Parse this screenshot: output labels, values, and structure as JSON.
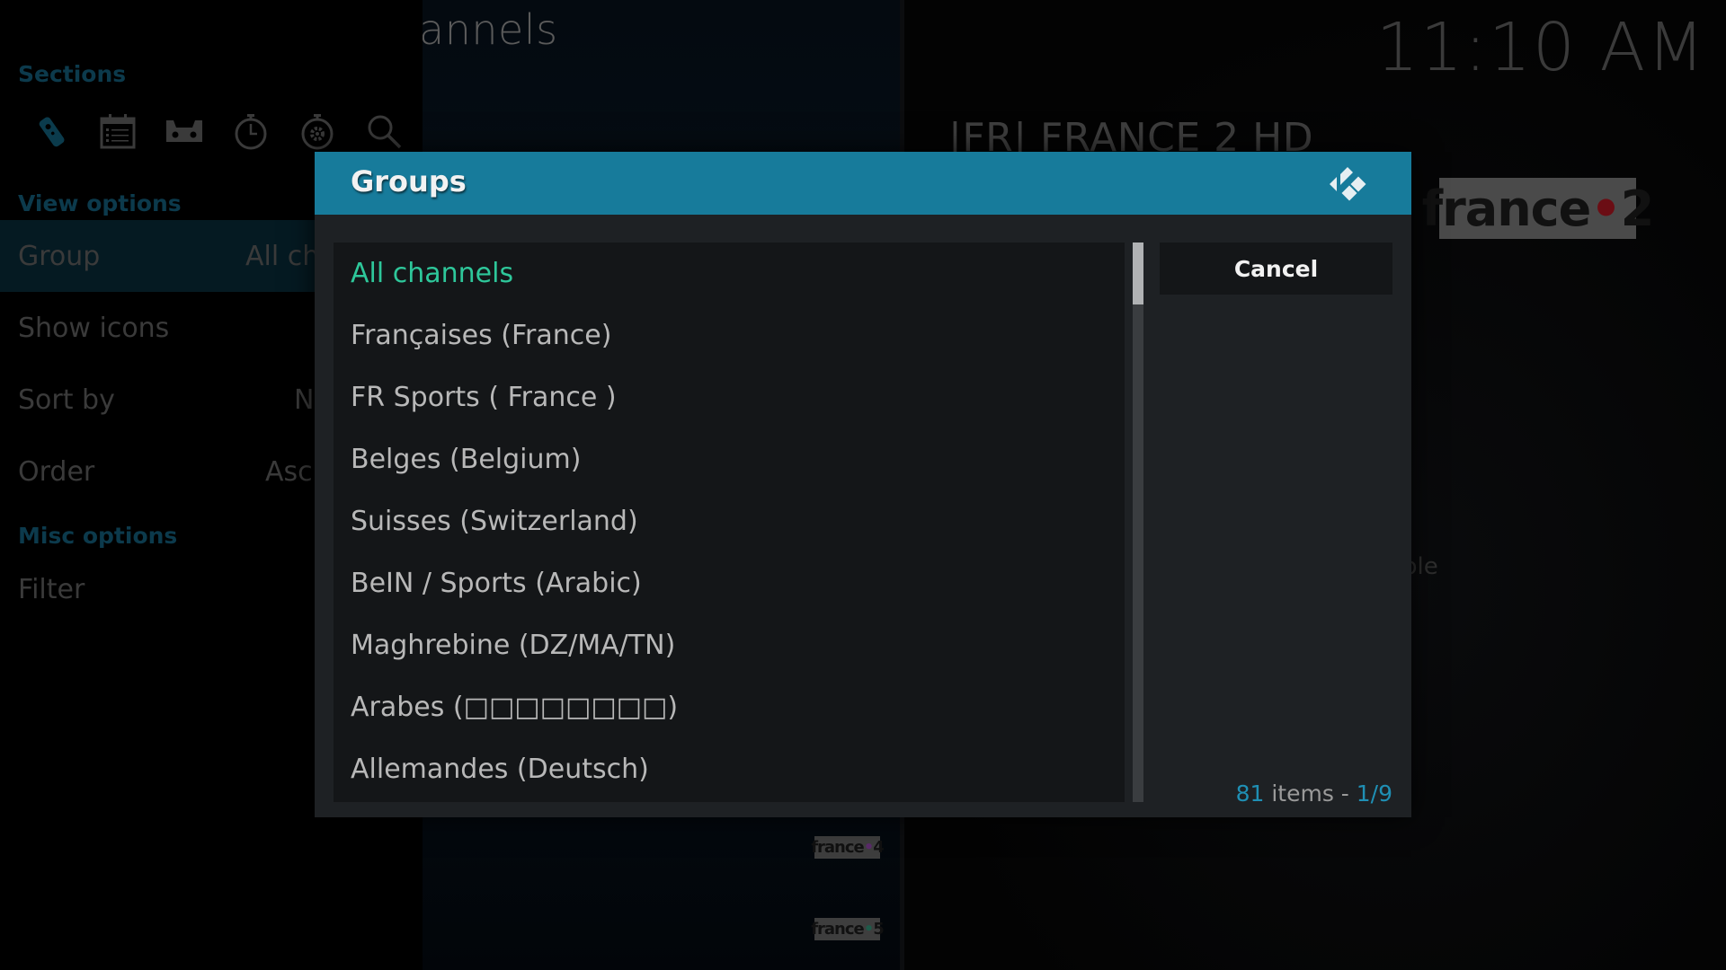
{
  "background": {
    "window_title_partial": "annels",
    "clock": "11:10 AM",
    "selected_channel_title": "|FR| FRANCE 2 HD",
    "partial_text": "ble",
    "logos": {
      "main": {
        "text": "france",
        "dot": "•",
        "num": "2"
      },
      "row1": {
        "text": "france",
        "dot": "•",
        "num": "4"
      },
      "row2": {
        "text": "france",
        "dot": "•",
        "num": "5"
      }
    }
  },
  "sidebar": {
    "sections_heading": "Sections",
    "section_icons": [
      {
        "name": "remote-icon",
        "active": true
      },
      {
        "name": "guide-calendar-icon",
        "active": false
      },
      {
        "name": "recordings-icon",
        "active": false
      },
      {
        "name": "timers-icon",
        "active": false
      },
      {
        "name": "timer-rules-icon",
        "active": false
      },
      {
        "name": "search-icon",
        "active": false
      }
    ],
    "view_options_heading": "View options",
    "rows": {
      "group": {
        "label": "Group",
        "value": "All ch"
      },
      "show_icons": {
        "label": "Show icons"
      },
      "sort_by": {
        "label": "Sort by",
        "value": "N"
      },
      "order": {
        "label": "Order",
        "value": "Asc"
      }
    },
    "misc_options_heading": "Misc options",
    "filter": {
      "label": "Filter"
    }
  },
  "dialog": {
    "title": "Groups",
    "items": [
      {
        "label": "All channels",
        "selected": true
      },
      {
        "label": "Françaises (France)",
        "selected": false
      },
      {
        "label": "FR Sports ( France )",
        "selected": false
      },
      {
        "label": "Belges (Belgium)",
        "selected": false
      },
      {
        "label": "Suisses (Switzerland)",
        "selected": false
      },
      {
        "label": "BeIN / Sports (Arabic)",
        "selected": false
      },
      {
        "label": "Maghrebine (DZ/MA/TN)",
        "selected": false
      },
      {
        "label": "Arabes (□□□□□□□□)",
        "selected": false
      },
      {
        "label": "Allemandes (Deutsch)",
        "selected": false
      }
    ],
    "cancel_label": "Cancel",
    "count": {
      "total": "81",
      "items_word": " items - ",
      "page": "1/9"
    },
    "scroll_fraction_visible": 0.111,
    "colors": {
      "header": "#177b9b",
      "selected_text": "#2ec79a",
      "accent_count": "#1f8fb4"
    }
  }
}
